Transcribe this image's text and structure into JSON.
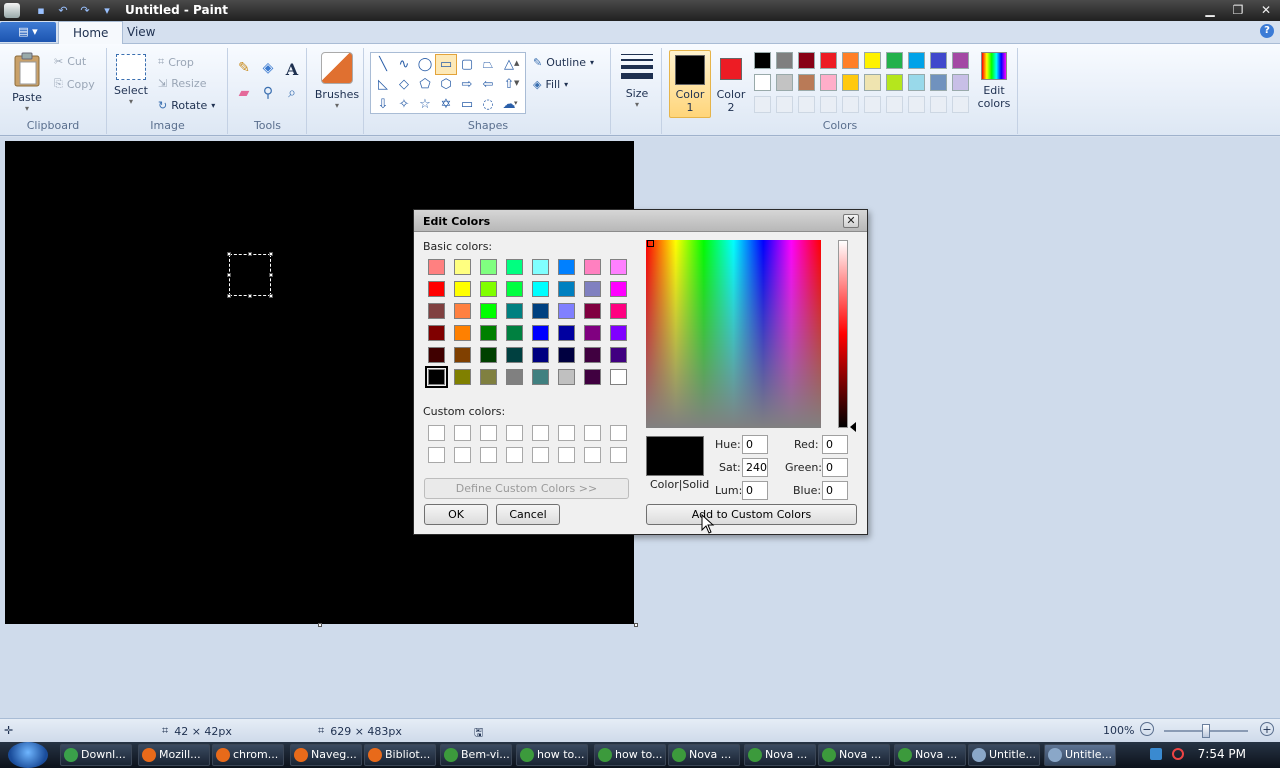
{
  "window": {
    "title": "Untitled - Paint",
    "qat_icons": [
      "save-icon",
      "undo-icon",
      "redo-icon",
      "customize-icon"
    ],
    "controls": [
      "minimize",
      "maximize",
      "close"
    ]
  },
  "tabs": [
    {
      "label": "Home",
      "active": true
    },
    {
      "label": "View",
      "active": false
    }
  ],
  "ribbon": {
    "clipboard": {
      "group_label": "Clipboard",
      "paste": "Paste",
      "cut": "Cut",
      "copy": "Copy"
    },
    "image": {
      "group_label": "Image",
      "select": "Select",
      "crop": "Crop",
      "resize": "Resize",
      "rotate": "Rotate"
    },
    "tools": {
      "group_label": "Tools",
      "icons": [
        "pencil-icon",
        "fill-icon",
        "text-icon",
        "eraser-icon",
        "color-picker-icon",
        "magnifier-icon"
      ]
    },
    "brushes": {
      "label": "Brushes"
    },
    "shapes": {
      "group_label": "Shapes",
      "outline": "Outline",
      "fill": "Fill"
    },
    "size": {
      "label": "Size"
    },
    "colors": {
      "group_label": "Colors",
      "color1": {
        "label": "Color",
        "num": "1",
        "value": "#000000"
      },
      "color2": {
        "label": "Color",
        "num": "2",
        "value": "#ed1c24"
      },
      "palette_row1": [
        "#000000",
        "#7f7f7f",
        "#880015",
        "#ed1c24",
        "#ff7f27",
        "#fff200",
        "#22b14c",
        "#00a2e8",
        "#3f48cc",
        "#a349a4"
      ],
      "palette_row2": [
        "#ffffff",
        "#c3c3c3",
        "#b97a57",
        "#ffaec9",
        "#ffc90e",
        "#efe4b0",
        "#b5e61d",
        "#99d9ea",
        "#7092be",
        "#c8bfe7"
      ],
      "edit_colors": "Edit colors"
    }
  },
  "dialog": {
    "title": "Edit Colors",
    "basic_colors_label": "Basic colors:",
    "basic_colors": [
      [
        "#ff8080",
        "#ffff80",
        "#80ff80",
        "#00ff80",
        "#80ffff",
        "#0080ff",
        "#ff80c0",
        "#ff80ff"
      ],
      [
        "#ff0000",
        "#ffff00",
        "#80ff00",
        "#00ff40",
        "#00ffff",
        "#0080c0",
        "#8080c0",
        "#ff00ff"
      ],
      [
        "#804040",
        "#ff8040",
        "#00ff00",
        "#008080",
        "#004080",
        "#8080ff",
        "#800040",
        "#ff0080"
      ],
      [
        "#800000",
        "#ff8000",
        "#008000",
        "#008040",
        "#0000ff",
        "#0000a0",
        "#800080",
        "#8000ff"
      ],
      [
        "#400000",
        "#804000",
        "#004000",
        "#004040",
        "#000080",
        "#000040",
        "#400040",
        "#400080"
      ],
      [
        "#000000",
        "#808000",
        "#808040",
        "#808080",
        "#408080",
        "#c0c0c0",
        "#400040",
        "#ffffff"
      ]
    ],
    "custom_colors_label": "Custom colors:",
    "define_custom": "Define Custom Colors >>",
    "ok": "OK",
    "cancel": "Cancel",
    "colorsolid": "Color|Solid",
    "hue_label": "Hue:",
    "hue": "0",
    "sat_label": "Sat:",
    "sat": "240",
    "lum_label": "Lum:",
    "lum": "0",
    "red_label": "Red:",
    "red": "0",
    "green_label": "Green:",
    "green": "0",
    "blue_label": "Blue:",
    "blue": "0",
    "add_custom": "Add to Custom Colors",
    "current_color": "#000000"
  },
  "status": {
    "selection_size": "42 × 42px",
    "canvas_size": "629 × 483px",
    "zoom": "100%"
  },
  "taskbar": {
    "items": [
      {
        "label": "Downl...",
        "icon": "download-icon",
        "color": "#3aa04a"
      },
      {
        "label": "Mozill...",
        "icon": "firefox-icon",
        "color": "#e86a1a"
      },
      {
        "label": "chrom...",
        "icon": "firefox-icon",
        "color": "#e86a1a"
      },
      {
        "label": "Naveg...",
        "icon": "firefox-icon",
        "color": "#e86a1a"
      },
      {
        "label": "Bibliot...",
        "icon": "firefox-icon",
        "color": "#e86a1a"
      },
      {
        "label": "Bem-vi...",
        "icon": "chrome-icon",
        "color": "#3c9a3c"
      },
      {
        "label": "how to...",
        "icon": "chrome-icon",
        "color": "#3c9a3c"
      },
      {
        "label": "how to...",
        "icon": "chrome-icon",
        "color": "#3c9a3c"
      },
      {
        "label": "Nova ...",
        "icon": "chrome-icon",
        "color": "#3c9a3c"
      },
      {
        "label": "Nova ...",
        "icon": "chrome-icon",
        "color": "#3c9a3c"
      },
      {
        "label": "Nova ...",
        "icon": "chrome-icon",
        "color": "#3c9a3c"
      },
      {
        "label": "Nova ...",
        "icon": "chrome-icon",
        "color": "#3c9a3c"
      },
      {
        "label": "Untitle...",
        "icon": "paint-icon",
        "color": "#8aa7c8"
      },
      {
        "label": "Untitle...",
        "icon": "paint-icon",
        "color": "#8aa7c8",
        "active": true
      }
    ],
    "clock": "7:54 PM"
  }
}
